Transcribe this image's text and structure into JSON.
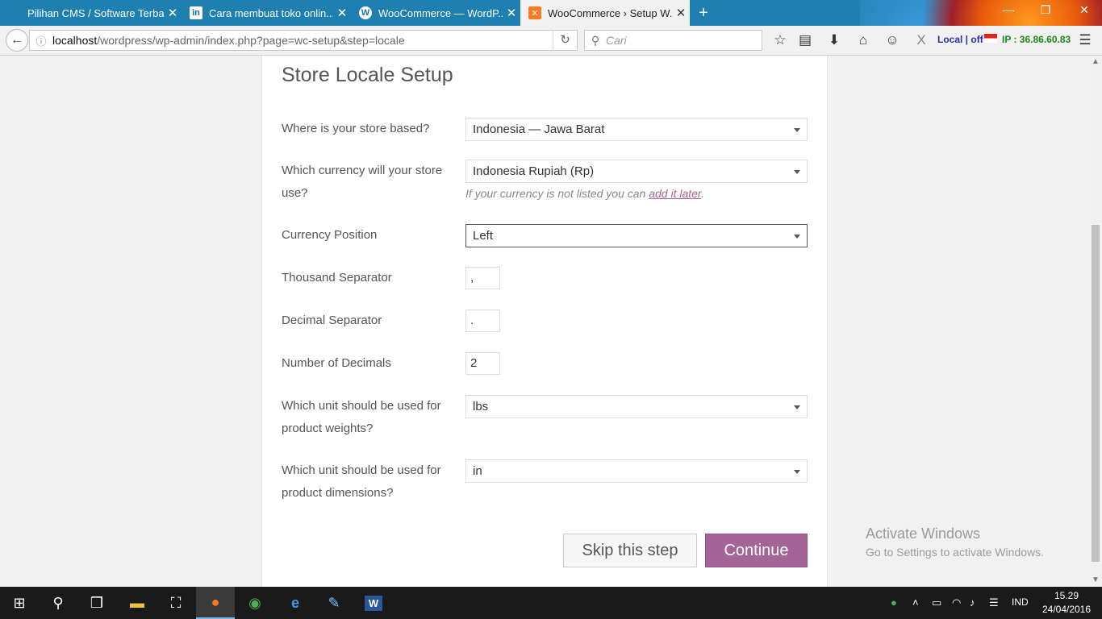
{
  "browser": {
    "tabs": [
      {
        "title": "Pilihan CMS / Software Terbai...",
        "favicon": "blank-page-icon",
        "active": false
      },
      {
        "title": "Cara membuat toko onlin...",
        "favicon": "linkedin-icon",
        "active": false
      },
      {
        "title": "WooCommerce — WordP...",
        "favicon": "wordpress-icon",
        "active": false
      },
      {
        "title": "WooCommerce › Setup W...",
        "favicon": "xampp-icon",
        "active": true
      }
    ],
    "url_host": "localhost",
    "url_path": "/wordpress/wp-admin/index.php?page=wc-setup&step=locale",
    "search_placeholder": "Cari",
    "addon_local": "Local | off",
    "addon_ip": "IP : 36.86.60.83"
  },
  "page": {
    "title": "Store Locale Setup",
    "fields": {
      "store_based": {
        "label": "Where is your store based?",
        "value": "Indonesia — Jawa Barat"
      },
      "currency": {
        "label": "Which currency will your store use?",
        "value": "Indonesia Rupiah (Rp)",
        "help_prefix": "If your currency is not listed you can ",
        "help_link": "add it later",
        "help_suffix": "."
      },
      "currency_position": {
        "label": "Currency Position",
        "value": "Left"
      },
      "thousand_separator": {
        "label": "Thousand Separator",
        "value": ","
      },
      "decimal_separator": {
        "label": "Decimal Separator",
        "value": "."
      },
      "number_of_decimals": {
        "label": "Number of Decimals",
        "value": "2"
      },
      "weight_unit": {
        "label": "Which unit should be used for product weights?",
        "value": "lbs"
      },
      "dimension_unit": {
        "label": "Which unit should be used for product dimensions?",
        "value": "in"
      }
    },
    "skip_label": "Skip this step",
    "continue_label": "Continue"
  },
  "watermark": {
    "line1": "Activate Windows",
    "line2": "Go to Settings to activate Windows."
  },
  "taskbar": {
    "language": "IND",
    "time": "15.29",
    "date": "24/04/2016"
  },
  "colors": {
    "woo_purple": "#a46497",
    "browser_blue": "#1e7fb0"
  }
}
